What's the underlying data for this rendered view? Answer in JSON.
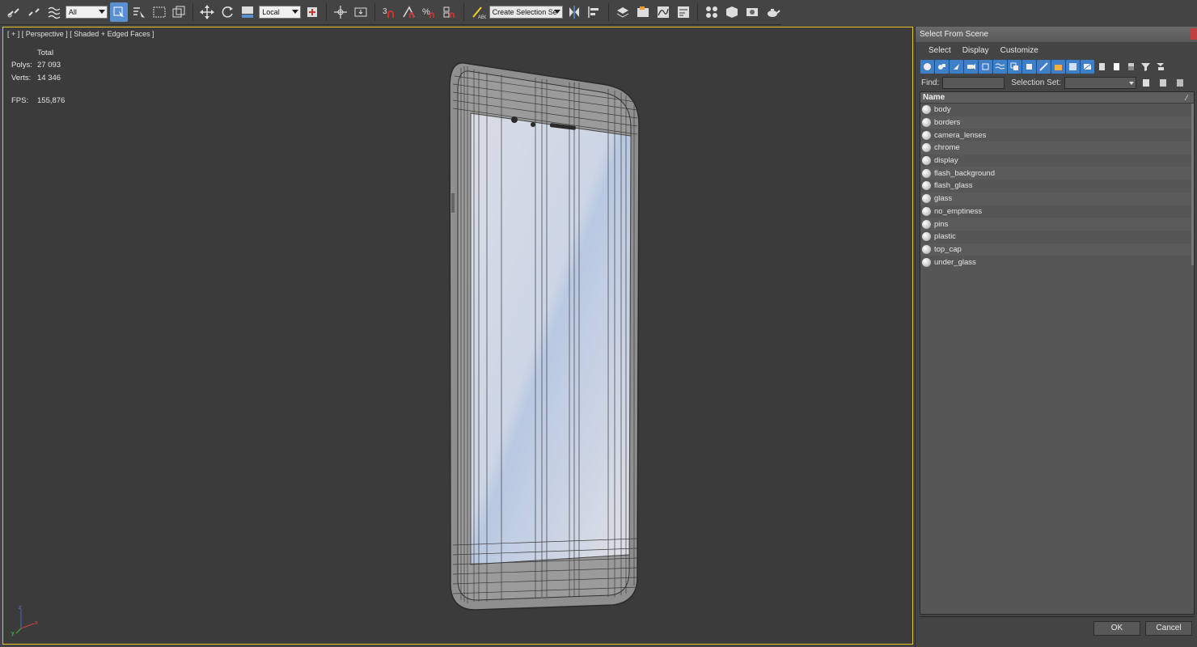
{
  "toolbar": {
    "filter_value": "All",
    "ref_coord_value": "Local",
    "selection_set_placeholder": "Create Selection Se"
  },
  "viewport": {
    "label": "[ + ] [ Perspective ] [ Shaded + Edged Faces ]",
    "stats": {
      "header": "Total",
      "polys_label": "Polys:",
      "polys_value": "27 093",
      "verts_label": "Verts:",
      "verts_value": "14 346",
      "fps_label": "FPS:",
      "fps_value": "155,876"
    },
    "axis": {
      "z": "z",
      "x": "x",
      "y": "y"
    }
  },
  "dialog": {
    "title": "Select From Scene",
    "menu": [
      "Select",
      "Display",
      "Customize"
    ],
    "find_label": "Find:",
    "selection_set_label": "Selection Set:",
    "column_name": "Name",
    "objects": [
      "body",
      "borders",
      "camera_lenses",
      "chrome",
      "display",
      "flash_background",
      "flash_glass",
      "glass",
      "no_emptiness",
      "pins",
      "plastic",
      "top_cap",
      "under_glass"
    ],
    "ok_label": "OK",
    "cancel_label": "Cancel"
  },
  "colors": {
    "viewport_border": "#e9c227",
    "stats_text": "#f0d020",
    "accent_blue": "#3d7fc9"
  }
}
